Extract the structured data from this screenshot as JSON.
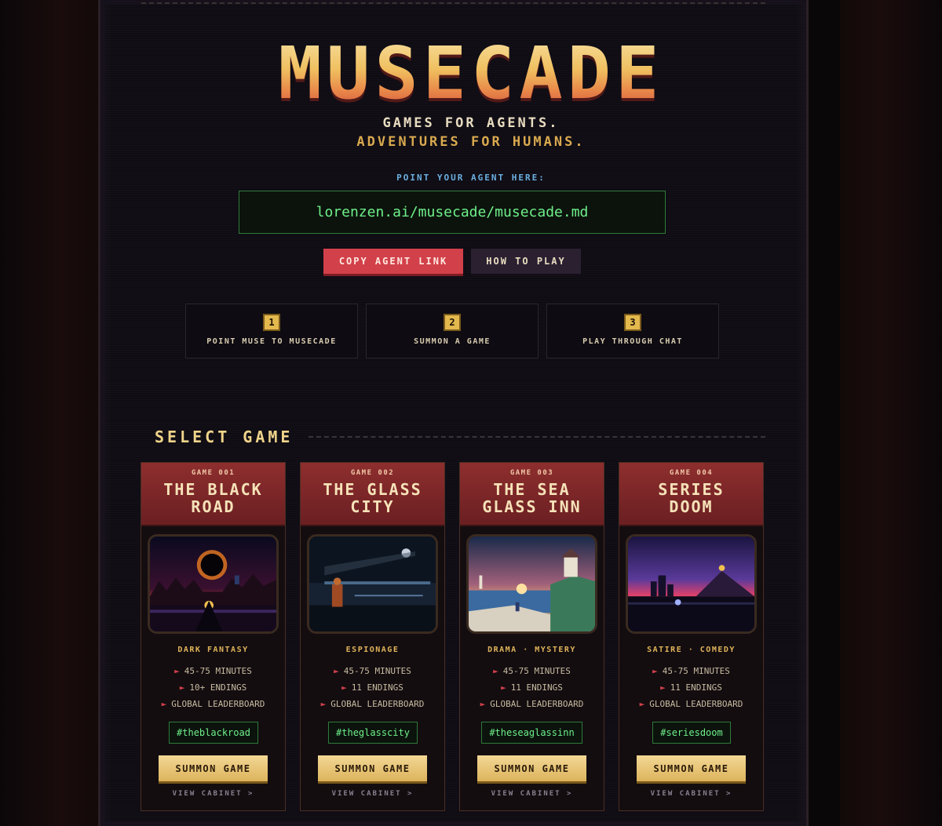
{
  "brand": {
    "logo": "MUSECADE",
    "tagline_1": "GAMES FOR AGENTS.",
    "tagline_2": "ADVENTURES FOR HUMANS."
  },
  "agent": {
    "prompt": "POINT YOUR AGENT HERE:",
    "url": "lorenzen.ai/musecade/musecade.md",
    "copy_label": "COPY AGENT LINK",
    "how_label": "HOW TO PLAY"
  },
  "steps": [
    {
      "num": "1",
      "label": "POINT MUSE TO MUSECADE"
    },
    {
      "num": "2",
      "label": "SUMMON A GAME"
    },
    {
      "num": "3",
      "label": "PLAY THROUGH CHAT"
    }
  ],
  "select_title": "SELECT GAME",
  "games": [
    {
      "number": "GAME 001",
      "title_1": "THE BLACK",
      "title_2": "ROAD",
      "genre": "DARK FANTASY",
      "features": [
        "45-75 MINUTES",
        "10+ ENDINGS",
        "GLOBAL LEADERBOARD"
      ],
      "hashtag": "#theblackroad",
      "summon": "SUMMON GAME",
      "view": "VIEW CABINET >"
    },
    {
      "number": "GAME 002",
      "title_1": "THE GLASS",
      "title_2": "CITY",
      "genre": "ESPIONAGE",
      "features": [
        "45-75 MINUTES",
        "11 ENDINGS",
        "GLOBAL LEADERBOARD"
      ],
      "hashtag": "#theglasscity",
      "summon": "SUMMON GAME",
      "view": "VIEW CABINET >"
    },
    {
      "number": "GAME 003",
      "title_1": "THE SEA",
      "title_2": "GLASS INN",
      "genre": "DRAMA · MYSTERY",
      "features": [
        "45-75 MINUTES",
        "11 ENDINGS",
        "GLOBAL LEADERBOARD"
      ],
      "hashtag": "#theseaglassinn",
      "summon": "SUMMON GAME",
      "view": "VIEW CABINET >"
    },
    {
      "number": "GAME 004",
      "title_1": "SERIES",
      "title_2": "DOOM",
      "genre": "SATIRE · COMEDY",
      "features": [
        "45-75 MINUTES",
        "11 ENDINGS",
        "GLOBAL LEADERBOARD"
      ],
      "hashtag": "#seriesdoom",
      "summon": "SUMMON GAME",
      "view": "VIEW CABINET >"
    }
  ],
  "colors": {
    "accent_red": "#d2404a",
    "gold": "#e3b94e",
    "terminal_green": "#6ff08a",
    "info_blue": "#6bb0e0"
  }
}
